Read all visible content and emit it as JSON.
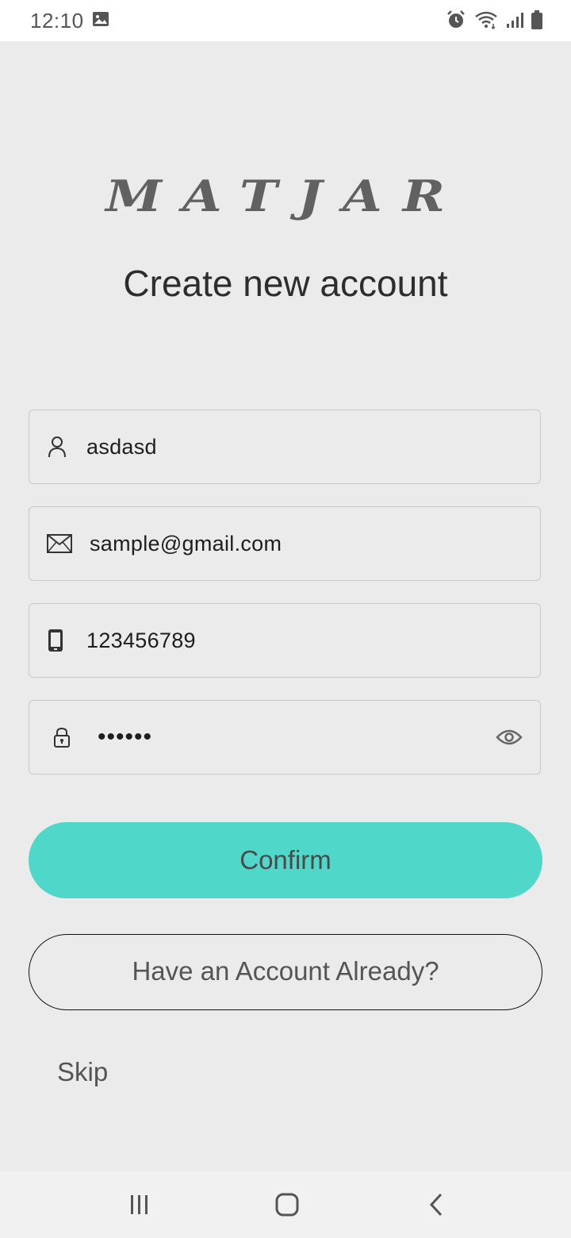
{
  "status_bar": {
    "time": "12:10",
    "left_icons": [
      "image-icon"
    ],
    "right_icons": [
      "alarm-icon",
      "wifi-icon",
      "signal-icon",
      "battery-icon"
    ]
  },
  "logo": {
    "text": "MATJAR"
  },
  "title": "Create new account",
  "form": {
    "name": {
      "value": "asdasd",
      "icon": "person-icon"
    },
    "email": {
      "value": "sample@gmail.com",
      "icon": "mail-icon"
    },
    "phone": {
      "value": "123456789",
      "icon": "phone-icon"
    },
    "password": {
      "value": "••••••",
      "icon": "lock-icon",
      "toggle_icon": "eye-icon"
    }
  },
  "buttons": {
    "confirm": "Confirm",
    "have_account": "Have an Account Already?",
    "skip": "Skip"
  },
  "nav_bar": {
    "icons": [
      "recent-apps-icon",
      "home-icon",
      "back-icon"
    ]
  },
  "colors": {
    "accent": "#4fd8c9",
    "background": "#ebebeb",
    "text": "#2d2d2d"
  }
}
